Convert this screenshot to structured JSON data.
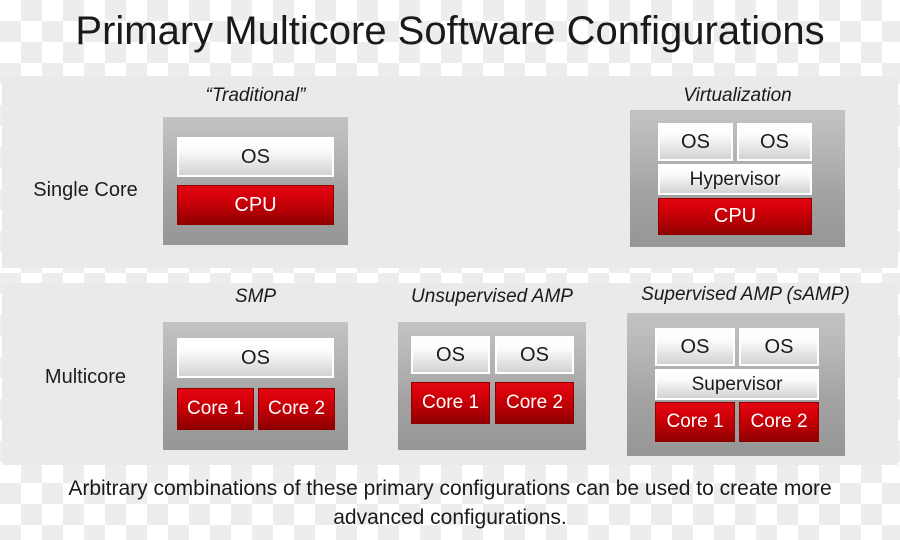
{
  "title": "Primary Multicore Software Configurations",
  "rows": [
    {
      "label": "Single Core"
    },
    {
      "label": "Multicore"
    }
  ],
  "configs": {
    "traditional": {
      "title": "“Traditional”",
      "os": "OS",
      "cpu": "CPU"
    },
    "virtualization": {
      "title": "Virtualization",
      "os1": "OS",
      "os2": "OS",
      "hypervisor": "Hypervisor",
      "cpu": "CPU"
    },
    "smp": {
      "title": "SMP",
      "os": "OS",
      "core1": "Core 1",
      "core2": "Core 2"
    },
    "unsupervised_amp": {
      "title": "Unsupervised AMP",
      "os1": "OS",
      "os2": "OS",
      "core1": "Core 1",
      "core2": "Core 2"
    },
    "supervised_amp": {
      "title": "Supervised AMP (sAMP)",
      "os1": "OS",
      "os2": "OS",
      "supervisor": "Supervisor",
      "core1": "Core 1",
      "core2": "Core 2"
    }
  },
  "caption": {
    "line1": "Arbitrary combinations of these primary configurations can be used to create more",
    "line2": "advanced configurations."
  },
  "colors": {
    "panel_background": "#eaeaea",
    "chip_gray_light": "#c3c3c3",
    "chip_gray_dark": "#969696",
    "cpu_red_light": "#e30613",
    "cpu_red_dark": "#8d0000",
    "os_white": "#ffffff",
    "text": "#1a1a1a"
  }
}
